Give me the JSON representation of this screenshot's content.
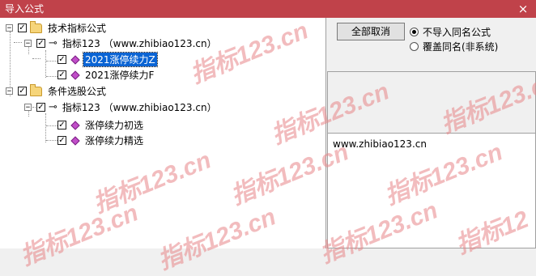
{
  "window": {
    "title": "导入公式",
    "close_symbol": "×"
  },
  "tree": [
    {
      "id": "n1",
      "label": "技术指标公式",
      "expander": "−",
      "checked": true,
      "icon": "folder-icon"
    },
    {
      "id": "n2",
      "label": "指标123  （www.zhibiao123.cn）",
      "expander": "−",
      "checked": true,
      "icon": "key-icon"
    },
    {
      "id": "n3",
      "label": "2021涨停续力Z",
      "checked": true,
      "icon": "formula-icon",
      "selected": true
    },
    {
      "id": "n4",
      "label": "2021涨停续力F",
      "checked": true,
      "icon": "formula-icon"
    },
    {
      "id": "n5",
      "label": "条件选股公式",
      "expander": "−",
      "checked": true,
      "icon": "folder-icon"
    },
    {
      "id": "n6",
      "label": "指标123  （www.zhibiao123.cn）",
      "expander": "−",
      "checked": true,
      "icon": "key-icon"
    },
    {
      "id": "n7",
      "label": "涨停续力初选",
      "checked": true,
      "icon": "formula-icon"
    },
    {
      "id": "n8",
      "label": "涨停续力精选",
      "checked": true,
      "icon": "formula-icon"
    }
  ],
  "check_mark": "✓",
  "buttons": {
    "cancel_all": "全部取消"
  },
  "radios": [
    {
      "label": "不导入同名公式",
      "selected": true
    },
    {
      "label": "覆盖同名(非系统)",
      "selected": false
    }
  ],
  "description": "www.zhibiao123.cn",
  "watermark": "指标123.cn",
  "colors": {
    "titlebar": "#c0424a",
    "selection": "#0a64d4",
    "watermark": "#e8878a"
  }
}
